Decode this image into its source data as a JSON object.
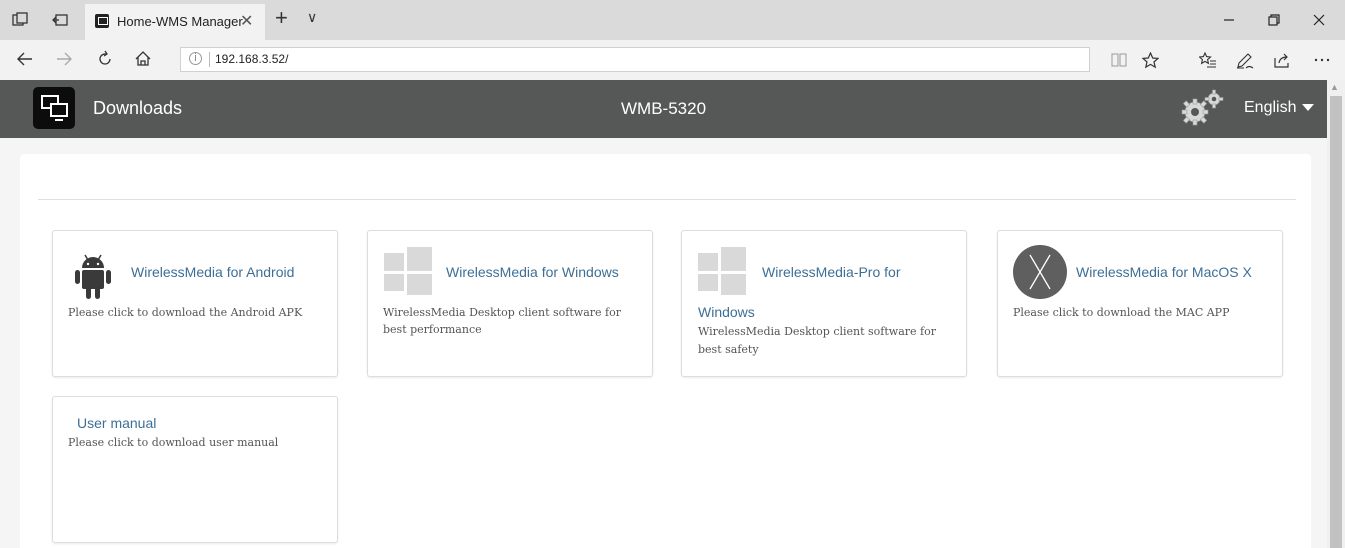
{
  "browser": {
    "tab_title": "Home-WMS Manager",
    "close_tab_glyph": "✕",
    "new_tab_glyph": "+",
    "tab_menu_glyph": "∨",
    "url": "192.168.3.52/",
    "icons": [
      "tab-preview-icon",
      "tab-set-aside-icon",
      "back-icon",
      "forward-icon",
      "refresh-icon",
      "home-icon",
      "site-info-icon",
      "reading-view-icon",
      "favorite-star-icon",
      "favorites-list-icon",
      "pen-notes-icon",
      "share-icon",
      "more-icon",
      "minimize-icon",
      "restore-icon",
      "close-window-icon"
    ]
  },
  "header": {
    "page_title": "Downloads",
    "model": "WMB-5320",
    "language": "English",
    "background_color": "#555856",
    "icons": [
      "screen-mirroring-logo-icon",
      "settings-gears-icon",
      "dropdown-caret-icon"
    ]
  },
  "downloads": [
    {
      "title": "WirelessMedia for Android",
      "desc_line1": "Please click to download the Android APK",
      "desc_line2": "",
      "icon": "android-icon"
    },
    {
      "title": "WirelessMedia for Windows",
      "desc_line1": "WirelessMedia Desktop client software for",
      "desc_line2": "best performance",
      "icon": "windows-icon"
    },
    {
      "title_line1": "WirelessMedia-Pro for",
      "title_line2": "Windows",
      "desc_line1": "WirelessMedia Desktop client software for",
      "desc_line2": "best safety",
      "icon": "windows-icon"
    },
    {
      "title": "WirelessMedia for MacOS X",
      "desc_line1": "Please click to download the MAC APP",
      "desc_line2": "",
      "icon": "macos-x-icon"
    },
    {
      "title": "User manual",
      "desc_line1": "Please click to download user manual",
      "desc_line2": ""
    }
  ],
  "colors": {
    "link": "#3d6f96",
    "tab_bar": "#dadada",
    "content_bg": "#f5f5f5"
  }
}
